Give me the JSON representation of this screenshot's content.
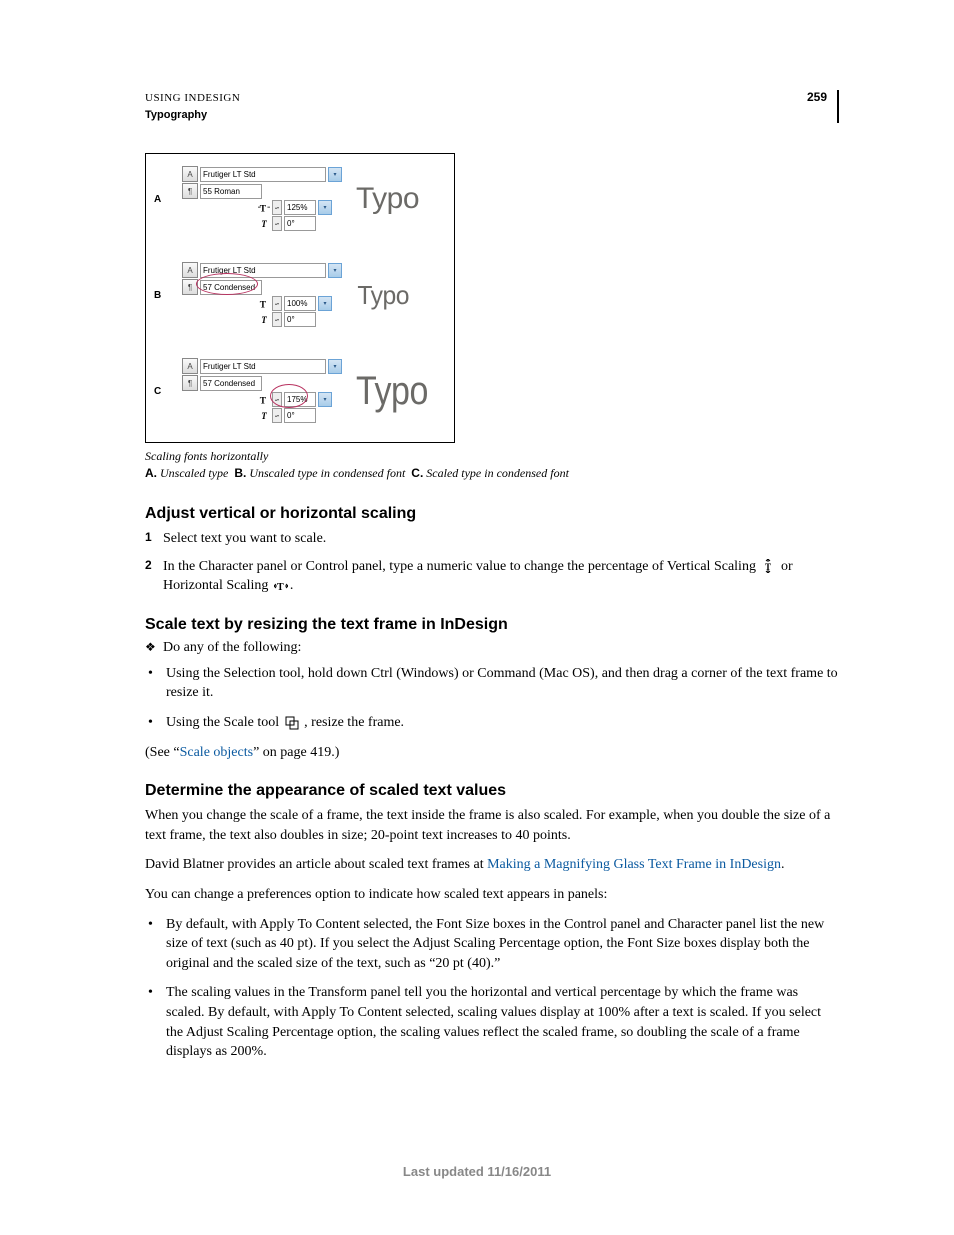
{
  "header": {
    "doc_title": "USING INDESIGN",
    "section": "Typography",
    "page_number": "259"
  },
  "figure": {
    "panels": [
      {
        "label": "A",
        "font_family": "Frutiger LT Std",
        "font_style": "55 Roman",
        "horiz_scale": "125%",
        "skew": "0°",
        "sample": "Typo",
        "circle_on": null
      },
      {
        "label": "B",
        "font_family": "Frutiger LT Std",
        "font_style": "57 Condensed",
        "horiz_scale": "100%",
        "skew": "0°",
        "sample": "Typo",
        "circle_on": "font_style"
      },
      {
        "label": "C",
        "font_family": "Frutiger LT Std",
        "font_style": "57 Condensed",
        "horiz_scale": "175%",
        "skew": "0°",
        "sample": "Typo",
        "circle_on": "horiz_scale"
      }
    ],
    "caption": "Scaling fonts horizontally",
    "legend": {
      "a_label": "A.",
      "a_text": "Unscaled type",
      "b_label": "B.",
      "b_text": "Unscaled type in condensed font",
      "c_label": "C.",
      "c_text": "Scaled type in condensed font"
    }
  },
  "section1": {
    "title": "Adjust vertical or horizontal scaling",
    "step1": "Select text you want to scale.",
    "step2_a": "In the Character panel or Control panel, type a numeric value to change the percentage of Vertical Scaling ",
    "step2_b": " or Horizontal Scaling ",
    "step2_c": "."
  },
  "section2": {
    "title": "Scale text by resizing the text frame in InDesign",
    "intro": "Do any of the following:",
    "bullet1": "Using the Selection tool, hold down Ctrl (Windows) or Command (Mac OS), and then drag a corner of the text frame to resize it.",
    "bullet2_a": "Using the Scale tool ",
    "bullet2_b": " , resize the frame.",
    "see_a": "(See “",
    "see_link": "Scale objects",
    "see_b": "” on page 419.)"
  },
  "section3": {
    "title": "Determine the appearance of scaled text values",
    "p1": "When you change the scale of a frame, the text inside the frame is also scaled. For example, when you double the size of a text frame, the text also doubles in size; 20-point text increases to 40 points.",
    "p2_a": "David Blatner provides an article about scaled text frames at ",
    "p2_link": "Making a Magnifying Glass Text Frame in InDesign",
    "p2_b": ".",
    "p3": "You can change a preferences option to indicate how scaled text appears in panels:",
    "bullet1": "By default, with Apply To Content selected, the Font Size boxes in the Control panel and Character panel list the new size of text (such as 40 pt). If you select the Adjust Scaling Percentage option, the Font Size boxes display both the original and the scaled size of the text, such as “20 pt (40).”",
    "bullet2": "The scaling values in the Transform panel tell you the horizontal and vertical percentage by which the frame was scaled. By default, with Apply To Content selected, scaling values display at 100% after a text is scaled. If you select the Adjust Scaling Percentage option, the scaling values reflect the scaled frame, so doubling the scale of a frame displays as 200%."
  },
  "footer": {
    "text": "Last updated 11/16/2011"
  }
}
